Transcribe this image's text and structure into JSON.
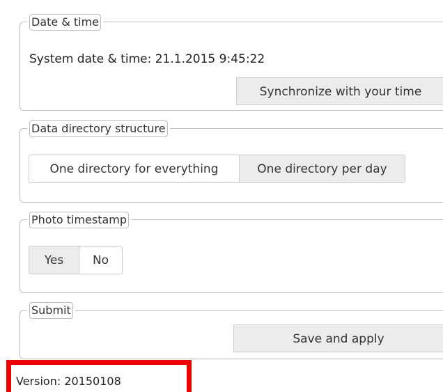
{
  "date_time": {
    "legend": "Date & time",
    "system_time": "System date & time: 21.1.2015 9:45:22",
    "sync_button": "Synchronize with your time"
  },
  "data_directory": {
    "legend": "Data directory structure",
    "options": [
      "One directory for everything",
      "One directory per day"
    ],
    "selected": "One directory for everything"
  },
  "photo_timestamp": {
    "legend": "Photo timestamp",
    "options": [
      "Yes",
      "No"
    ],
    "selected": "No"
  },
  "submit": {
    "legend": "Submit",
    "save_button": "Save and apply"
  },
  "footer": {
    "version": "Version: 20150108"
  },
  "colors": {
    "highlight_border": "#ee0000",
    "button_bg": "#ececec",
    "active_button_bg": "#ffffff",
    "group_border": "#bdbdbd"
  }
}
